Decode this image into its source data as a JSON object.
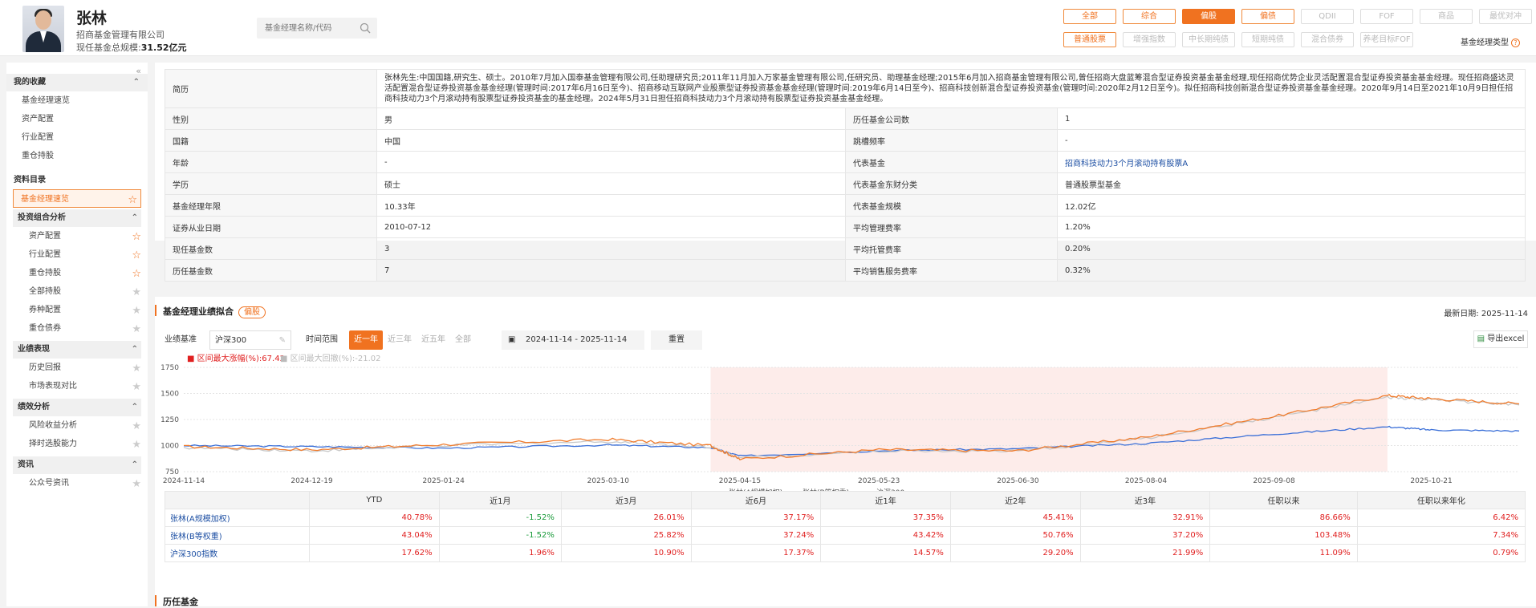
{
  "manager": {
    "name": "张林",
    "company": "招商基金管理有限公司",
    "scale_label": "现任基金总规模:",
    "scale_value": "31.52亿元"
  },
  "search": {
    "placeholder": "基金经理名称/代码"
  },
  "filters_row1": [
    {
      "label": "全部",
      "state": "on"
    },
    {
      "label": "综合",
      "state": "on"
    },
    {
      "label": "偏股",
      "state": "active"
    },
    {
      "label": "偏债",
      "state": "on"
    },
    {
      "label": "QDII",
      "state": "off"
    },
    {
      "label": "FOF",
      "state": "off"
    },
    {
      "label": "商品",
      "state": "off"
    },
    {
      "label": "最优对冲",
      "state": "off"
    }
  ],
  "filters_row2": [
    {
      "label": "普通股票",
      "state": "on"
    },
    {
      "label": "增强指数",
      "state": "off"
    },
    {
      "label": "中长期纯债",
      "state": "off"
    },
    {
      "label": "短期纯债",
      "state": "off"
    },
    {
      "label": "混合债券",
      "state": "off"
    },
    {
      "label": "养老目标FOF",
      "state": "off"
    }
  ],
  "manager_type_label": "基金经理类型",
  "sidebar": {
    "collapse": "«",
    "favorites_title": "我的收藏",
    "favorites": [
      "基金经理速览",
      "资产配置",
      "行业配置",
      "重仓持股"
    ],
    "catalog_title": "资料目录",
    "active_item": "基金经理速览",
    "groups": [
      {
        "title": "投资组合分析",
        "items": [
          {
            "label": "资产配置",
            "starred": true
          },
          {
            "label": "行业配置",
            "starred": true
          },
          {
            "label": "重仓持股",
            "starred": true
          },
          {
            "label": "全部持股",
            "starred": false
          },
          {
            "label": "券种配置",
            "starred": false
          },
          {
            "label": "重仓债券",
            "starred": false
          }
        ]
      },
      {
        "title": "业绩表现",
        "items": [
          {
            "label": "历史回报",
            "starred": false
          },
          {
            "label": "市场表现对比",
            "starred": false
          }
        ]
      },
      {
        "title": "绩效分析",
        "items": [
          {
            "label": "风险收益分析",
            "starred": false
          },
          {
            "label": "择时选股能力",
            "starred": false
          }
        ]
      },
      {
        "title": "资讯",
        "items": [
          {
            "label": "公众号资讯",
            "starred": false
          }
        ]
      }
    ]
  },
  "bio": {
    "label": "简历",
    "text": "张林先生:中国国籍,研究生、硕士。2010年7月加入国泰基金管理有限公司,任助理研究员;2011年11月加入万家基金管理有限公司,任研究员、助理基金经理;2015年6月加入招商基金管理有限公司,曾任招商大盘蓝筹混合型证券投资基金基金经理,现任招商优势企业灵活配置混合型证券投资基金基金经理。现任招商盛达灵活配置混合型证券投资基金基金经理(管理时间:2017年6月16日至今)、招商移动互联网产业股票型证券投资基金基金经理(管理时间:2019年6月14日至今)、招商科技创新混合型证券投资基金(管理时间:2020年2月12日至今)。拟任招商科技创新混合型证券投资基金基金经理。2020年9月14日至2021年10月9日担任招商科技动力3个月滚动持有股票型证券投资基金的基金经理。2024年5月31日担任招商科技动力3个月滚动持有股票型证券投资基金基金经理。"
  },
  "info_rows": [
    {
      "l1": "性别",
      "v1": "男",
      "l2": "历任基金公司数",
      "v2": "1",
      "link": false
    },
    {
      "l1": "国籍",
      "v1": "中国",
      "l2": "跳槽频率",
      "v2": "-",
      "link": false
    },
    {
      "l1": "年龄",
      "v1": "-",
      "l2": "代表基金",
      "v2": "招商科技动力3个月滚动持有股票A",
      "link": true
    },
    {
      "l1": "学历",
      "v1": "硕士",
      "l2": "代表基金东财分类",
      "v2": "普通股票型基金",
      "link": false
    },
    {
      "l1": "基金经理年限",
      "v1": "10.33年",
      "l2": "代表基金规模",
      "v2": "12.02亿",
      "link": false
    },
    {
      "l1": "证券从业日期",
      "v1": "2010-07-12",
      "l2": "平均管理费率",
      "v2": "1.20%",
      "link": false
    },
    {
      "l1": "现任基金数",
      "v1": "3",
      "l2": "平均托管费率",
      "v2": "0.20%",
      "link": false
    },
    {
      "l1": "历任基金数",
      "v1": "7",
      "l2": "平均销售服务费率",
      "v2": "0.32%",
      "link": false
    }
  ],
  "perf_section": {
    "title": "基金经理业绩拟合",
    "pill": "偏股",
    "latest_label": "最新日期:",
    "latest_date": "2025-11-14",
    "bench_label": "业绩基准",
    "bench_value": "沪深300",
    "range_label": "时间范围",
    "ranges": [
      {
        "label": "近一年",
        "on": true
      },
      {
        "label": "近三年",
        "on": false
      },
      {
        "label": "近五年",
        "on": false
      },
      {
        "label": "全部",
        "on": false
      }
    ],
    "date_from": "2024-11-14",
    "date_sep": "-",
    "date_to": "2025-11-14",
    "reset": "重置",
    "export": "导出excel",
    "maxup_label": "区间最大涨幅(%):",
    "maxup_value": "67.42",
    "maxdown_label": "区间最大回撤(%):",
    "maxdown_value": "-21.02"
  },
  "chart_data": {
    "type": "line",
    "y_ticks": [
      750,
      1000,
      1250,
      1500,
      1750
    ],
    "ylim": [
      750,
      1750
    ],
    "x_ticks": [
      "2024-11-14",
      "2024-12-19",
      "2025-01-24",
      "2025-03-10",
      "2025-04-15",
      "2025-05-23",
      "2025-06-30",
      "2025-08-04",
      "2025-09-08",
      "2025-10-21"
    ],
    "x": [
      "2024-11-14",
      "2024-12-19",
      "2025-01-24",
      "2025-03-10",
      "2025-04-07",
      "2025-04-15",
      "2025-05-23",
      "2025-06-30",
      "2025-08-04",
      "2025-09-08",
      "2025-10-09",
      "2025-10-21",
      "2025-11-14"
    ],
    "highlight_range": [
      "2025-04-07",
      "2025-10-09"
    ],
    "series": [
      {
        "name": "张林(A规模加权)",
        "color": "#f07a2a",
        "values": [
          990,
          960,
          1010,
          1060,
          1000,
          870,
          960,
          950,
          1080,
          1280,
          1480,
          1450,
          1400
        ]
      },
      {
        "name": "张林(B等权重)",
        "color": "#c8c8c8",
        "values": [
          980,
          950,
          1000,
          1040,
          990,
          880,
          950,
          945,
          1070,
          1270,
          1460,
          1440,
          1390
        ]
      },
      {
        "name": "沪深300",
        "color": "#3a6fd8",
        "values": [
          1000,
          990,
          975,
          1005,
          980,
          900,
          950,
          970,
          1020,
          1110,
          1180,
          1150,
          1140
        ]
      }
    ]
  },
  "perf_table": {
    "headers": [
      "",
      "YTD",
      "近1月",
      "近3月",
      "近6月",
      "近1年",
      "近2年",
      "近3年",
      "任职以来",
      "任职以来年化"
    ],
    "rows": [
      {
        "name": "张林(A规模加权)",
        "values": [
          "40.78%",
          "-1.52%",
          "26.01%",
          "37.17%",
          "37.35%",
          "45.41%",
          "32.91%",
          "86.66%",
          "6.42%"
        ]
      },
      {
        "name": "张林(B等权重)",
        "values": [
          "43.04%",
          "-1.52%",
          "25.82%",
          "37.24%",
          "43.42%",
          "50.76%",
          "37.20%",
          "103.48%",
          "7.34%"
        ]
      },
      {
        "name": "沪深300指数",
        "values": [
          "17.62%",
          "1.96%",
          "10.90%",
          "17.37%",
          "14.57%",
          "29.20%",
          "21.99%",
          "11.09%",
          "0.79%"
        ]
      }
    ]
  },
  "history_section": {
    "title": "历任基金"
  }
}
